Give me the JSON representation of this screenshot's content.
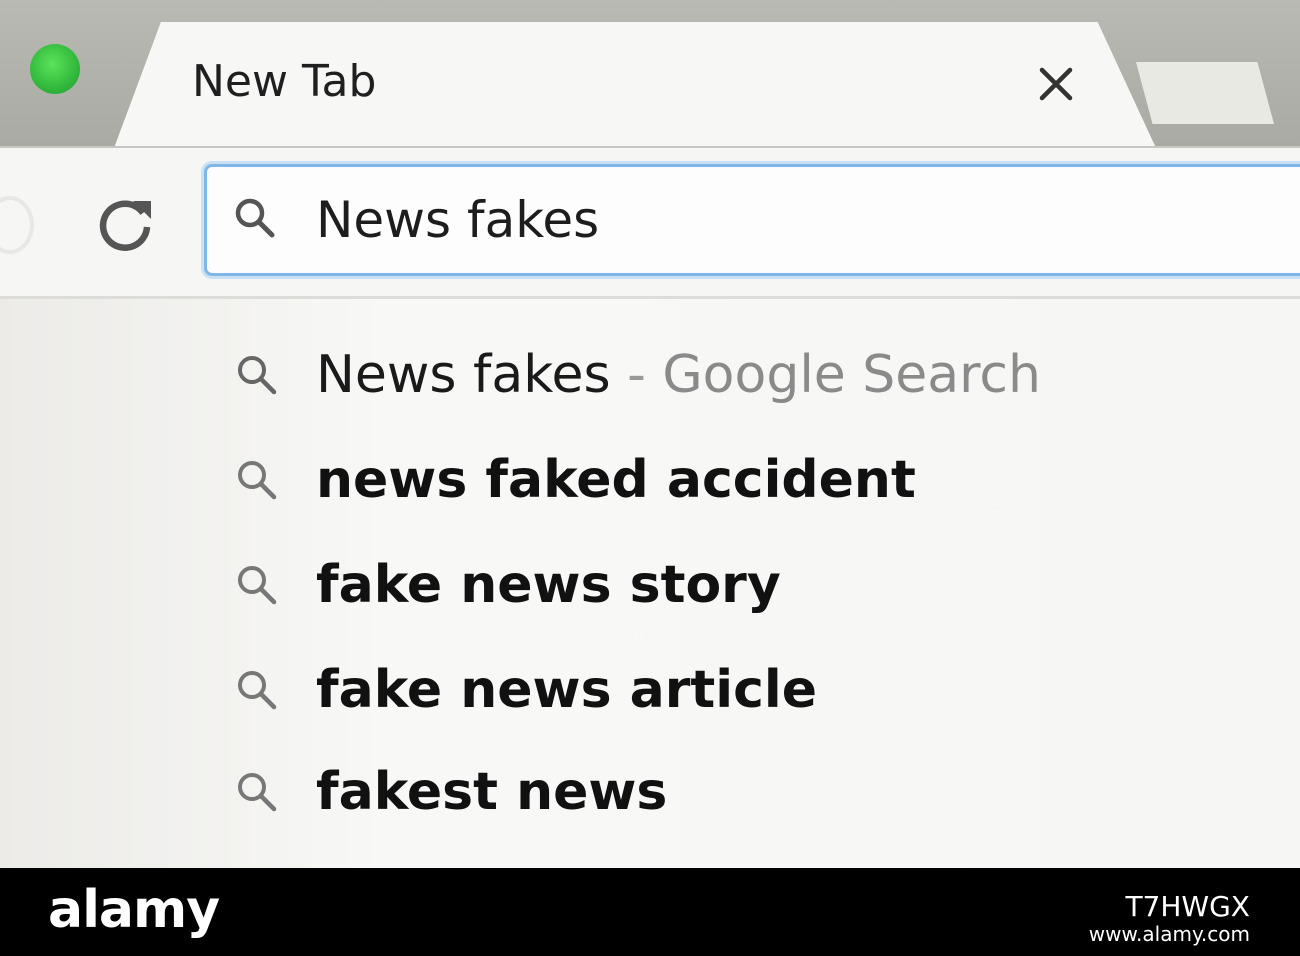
{
  "tab": {
    "title": "New Tab",
    "close_icon": "close-icon"
  },
  "toolbar": {
    "reload_icon": "reload-icon"
  },
  "omnibox": {
    "icon": "search-icon",
    "value": "News fakes",
    "accent_color": "#7fb8e6"
  },
  "suggestions": [
    {
      "query": "News fakes",
      "separator": " - ",
      "description": "Google Search",
      "icon": "search-icon"
    },
    {
      "text": "news faked accident",
      "icon": "search-icon"
    },
    {
      "text": "fake news story",
      "icon": "search-icon"
    },
    {
      "text": "fake news article",
      "icon": "search-icon"
    },
    {
      "text": "fakest news",
      "icon": "search-icon"
    }
  ],
  "watermark": {
    "logo": "alamy",
    "image_id": "T7HWGX",
    "url": "www.alamy.com"
  }
}
